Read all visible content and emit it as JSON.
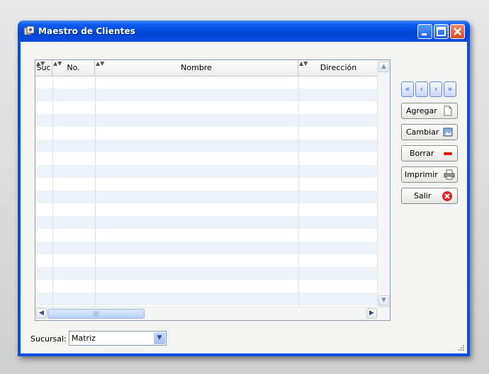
{
  "window": {
    "title": "Maestro de Clientes",
    "titlebar_color": "#0a4ee0"
  },
  "grid": {
    "columns": [
      {
        "label": "Suc"
      },
      {
        "label": "No."
      },
      {
        "label": "Nombre"
      },
      {
        "label": "Dirección"
      }
    ],
    "row_stripe_color": "#eef3fb"
  },
  "nav": {
    "first_icon": "double-chevron-left-icon",
    "prev_icon": "chevron-left-icon",
    "next_icon": "chevron-right-icon",
    "last_icon": "double-chevron-right-icon"
  },
  "actions": {
    "agregar": "Agregar",
    "cambiar": "Cambiar",
    "borrar": "Borrar",
    "imprimir": "Imprimir",
    "salir": "Salir"
  },
  "filter": {
    "label": "Sucursal:",
    "value": "Matriz"
  }
}
